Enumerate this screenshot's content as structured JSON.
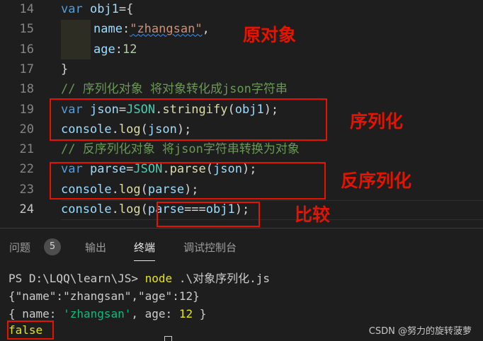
{
  "editor": {
    "lines": [
      {
        "n": "14",
        "segs": [
          [
            "kw",
            "var "
          ],
          [
            "var",
            "obj1"
          ],
          [
            "pl",
            "={"
          ]
        ]
      },
      {
        "n": "15",
        "segs": [
          [
            "ind",
            ""
          ],
          [
            "var",
            "name"
          ],
          [
            "pl",
            ":"
          ],
          [
            "str",
            "\"zhangsan\""
          ],
          [
            "pl",
            ","
          ]
        ]
      },
      {
        "n": "16",
        "segs": [
          [
            "ind",
            ""
          ],
          [
            "var",
            "age"
          ],
          [
            "pl",
            ":"
          ],
          [
            "num",
            "12"
          ]
        ]
      },
      {
        "n": "17",
        "segs": [
          [
            "pl",
            "}"
          ]
        ]
      },
      {
        "n": "18",
        "segs": [
          [
            "cm",
            "// 序列化对象 将对象转化成json字符串"
          ]
        ]
      },
      {
        "n": "19",
        "segs": [
          [
            "kw",
            "var "
          ],
          [
            "var",
            "json"
          ],
          [
            "pl",
            "="
          ],
          [
            "cls",
            "JSON"
          ],
          [
            "pl",
            "."
          ],
          [
            "fn",
            "stringify"
          ],
          [
            "pl",
            "("
          ],
          [
            "var",
            "obj1"
          ],
          [
            "pl",
            ");"
          ]
        ]
      },
      {
        "n": "20",
        "segs": [
          [
            "var",
            "console"
          ],
          [
            "pl",
            "."
          ],
          [
            "fn",
            "log"
          ],
          [
            "pl",
            "("
          ],
          [
            "var",
            "json"
          ],
          [
            "pl",
            ");"
          ]
        ]
      },
      {
        "n": "21",
        "segs": [
          [
            "cm",
            "// 反序列化对象 将json字符串转换为对象"
          ]
        ]
      },
      {
        "n": "22",
        "segs": [
          [
            "kw",
            "var "
          ],
          [
            "var",
            "parse"
          ],
          [
            "pl",
            "="
          ],
          [
            "cls",
            "JSON"
          ],
          [
            "pl",
            "."
          ],
          [
            "fn",
            "parse"
          ],
          [
            "pl",
            "("
          ],
          [
            "var",
            "json"
          ],
          [
            "pl",
            ");"
          ]
        ]
      },
      {
        "n": "23",
        "segs": [
          [
            "var",
            "console"
          ],
          [
            "pl",
            "."
          ],
          [
            "fn",
            "log"
          ],
          [
            "pl",
            "("
          ],
          [
            "var",
            "parse"
          ],
          [
            "pl",
            ");"
          ]
        ]
      },
      {
        "n": "24",
        "segs": [
          [
            "var",
            "console"
          ],
          [
            "pl",
            "."
          ],
          [
            "fn",
            "log"
          ],
          [
            "pl",
            "("
          ],
          [
            "var",
            "parse"
          ],
          [
            "pl",
            "==="
          ],
          [
            "var",
            "obj1"
          ],
          [
            "pl",
            ");"
          ]
        ]
      }
    ]
  },
  "annotations": {
    "original_object": "原对象",
    "serialize": "序列化",
    "deserialize": "反序列化",
    "compare": "比较"
  },
  "panel": {
    "tabs": {
      "problems": "问题",
      "problems_count": "5",
      "output": "输出",
      "terminal": "终端",
      "debug_console": "调试控制台"
    },
    "terminal": {
      "prompt": "PS D:\\LQQ\\learn\\JS> ",
      "command": "node",
      "command_arg": " .\\对象序列化.js",
      "out_json": "{\"name\":\"zhangsan\",\"age\":12}",
      "out_obj_open": "{ name: ",
      "out_obj_name": "'zhangsan'",
      "out_obj_mid": ", age: ",
      "out_obj_age": "12",
      "out_obj_close": " }",
      "out_bool": "false"
    }
  },
  "watermark": "CSDN @努力的旋转菠萝",
  "colors": {
    "keyword": "#569cd6",
    "variable": "#9cdcfe",
    "function": "#dcdcaa",
    "string": "#ce9178",
    "number": "#b5cea8",
    "comment": "#6a9955",
    "annotation_red": "#e51400"
  }
}
